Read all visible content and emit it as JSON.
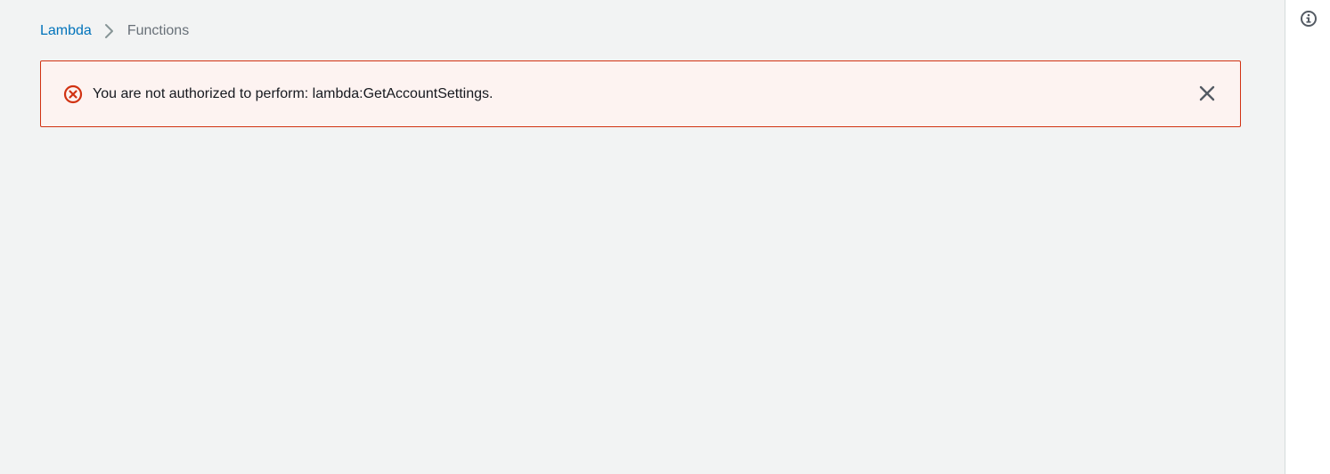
{
  "breadcrumb": {
    "items": [
      {
        "label": "Lambda",
        "link": true
      },
      {
        "label": "Functions",
        "link": false
      }
    ],
    "separator_icon": "chevron-right-icon"
  },
  "alert": {
    "type": "error",
    "icon": "error-circle-x-icon",
    "message": "You are not authorized to perform: lambda:GetAccountSettings.",
    "dismiss_icon": "close-icon"
  },
  "tools_panel": {
    "info_icon": "info-icon"
  },
  "colors": {
    "page_background": "#f2f3f3",
    "link": "#0073bb",
    "muted_text": "#687078",
    "error": "#d13212",
    "error_background": "#fdf3f1",
    "text": "#16191f",
    "panel_background": "#ffffff"
  }
}
